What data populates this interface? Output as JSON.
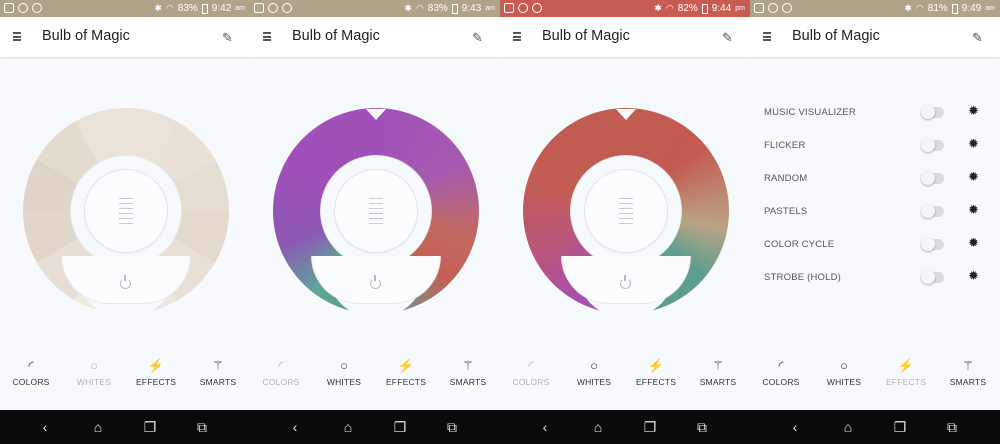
{
  "panels": [
    {
      "status": {
        "battery": "83%",
        "time": "9:42",
        "ampm": "am"
      },
      "app_title": "Bulb of Magic",
      "view": "whites",
      "tabs": [
        {
          "label": "COLORS",
          "icon": "rainbow-icon",
          "glyph": "◜",
          "state": "normal"
        },
        {
          "label": "WHITES",
          "icon": "sun-icon",
          "glyph": "○",
          "state": "dim"
        },
        {
          "label": "EFFECTS",
          "icon": "lightning-icon",
          "glyph": "⚡",
          "state": "normal"
        },
        {
          "label": "SMARTS",
          "icon": "magic-wand-icon",
          "glyph": "⚚",
          "state": "normal"
        }
      ]
    },
    {
      "status": {
        "battery": "83%",
        "time": "9:43",
        "ampm": "am"
      },
      "app_title": "Bulb of Magic",
      "view": "color-wheel-purple",
      "tabs": [
        {
          "label": "COLORS",
          "icon": "rainbow-icon",
          "glyph": "◜",
          "state": "dim"
        },
        {
          "label": "WHITES",
          "icon": "sun-icon",
          "glyph": "○",
          "state": "normal"
        },
        {
          "label": "EFFECTS",
          "icon": "lightning-icon",
          "glyph": "⚡",
          "state": "normal"
        },
        {
          "label": "SMARTS",
          "icon": "magic-wand-icon",
          "glyph": "⚚",
          "state": "normal"
        }
      ]
    },
    {
      "status": {
        "battery": "82%",
        "time": "9:44",
        "ampm": "pm"
      },
      "app_title": "Bulb of Magic",
      "view": "color-wheel-red",
      "tabs": [
        {
          "label": "COLORS",
          "icon": "rainbow-icon",
          "glyph": "◜",
          "state": "dim"
        },
        {
          "label": "WHITES",
          "icon": "sun-icon",
          "glyph": "○",
          "state": "normal"
        },
        {
          "label": "EFFECTS",
          "icon": "lightning-icon",
          "glyph": "⚡",
          "state": "normal"
        },
        {
          "label": "SMARTS",
          "icon": "magic-wand-icon",
          "glyph": "⚚",
          "state": "normal"
        }
      ]
    },
    {
      "status": {
        "battery": "81%",
        "time": "9:49",
        "ampm": "am"
      },
      "app_title": "Bulb of Magic",
      "view": "effects-list",
      "effects": [
        {
          "label": "MUSIC VISUALIZER",
          "enabled": false
        },
        {
          "label": "FLICKER",
          "enabled": false
        },
        {
          "label": "RANDOM",
          "enabled": false
        },
        {
          "label": "PASTELS",
          "enabled": false
        },
        {
          "label": "COLOR CYCLE",
          "enabled": false
        },
        {
          "label": "STROBE (HOLD)",
          "enabled": false
        }
      ],
      "tabs": [
        {
          "label": "COLORS",
          "icon": "rainbow-icon",
          "glyph": "◜",
          "state": "normal"
        },
        {
          "label": "WHITES",
          "icon": "sun-icon",
          "glyph": "○",
          "state": "normal"
        },
        {
          "label": "EFFECTS",
          "icon": "lightning-icon",
          "glyph": "⚡",
          "state": "dim"
        },
        {
          "label": "SMARTS",
          "icon": "magic-wand-icon",
          "glyph": "⚚",
          "state": "normal"
        }
      ]
    }
  ],
  "nav": {
    "back": "‹",
    "home": "⌂",
    "recents": "❐",
    "screenshot": "⧉"
  },
  "colors": {
    "statusbar": "#ada48a",
    "statusbar_alt": "#c95c52",
    "purple": "#a050b8",
    "red": "#c05c52",
    "teal": "#5e9d8f"
  }
}
